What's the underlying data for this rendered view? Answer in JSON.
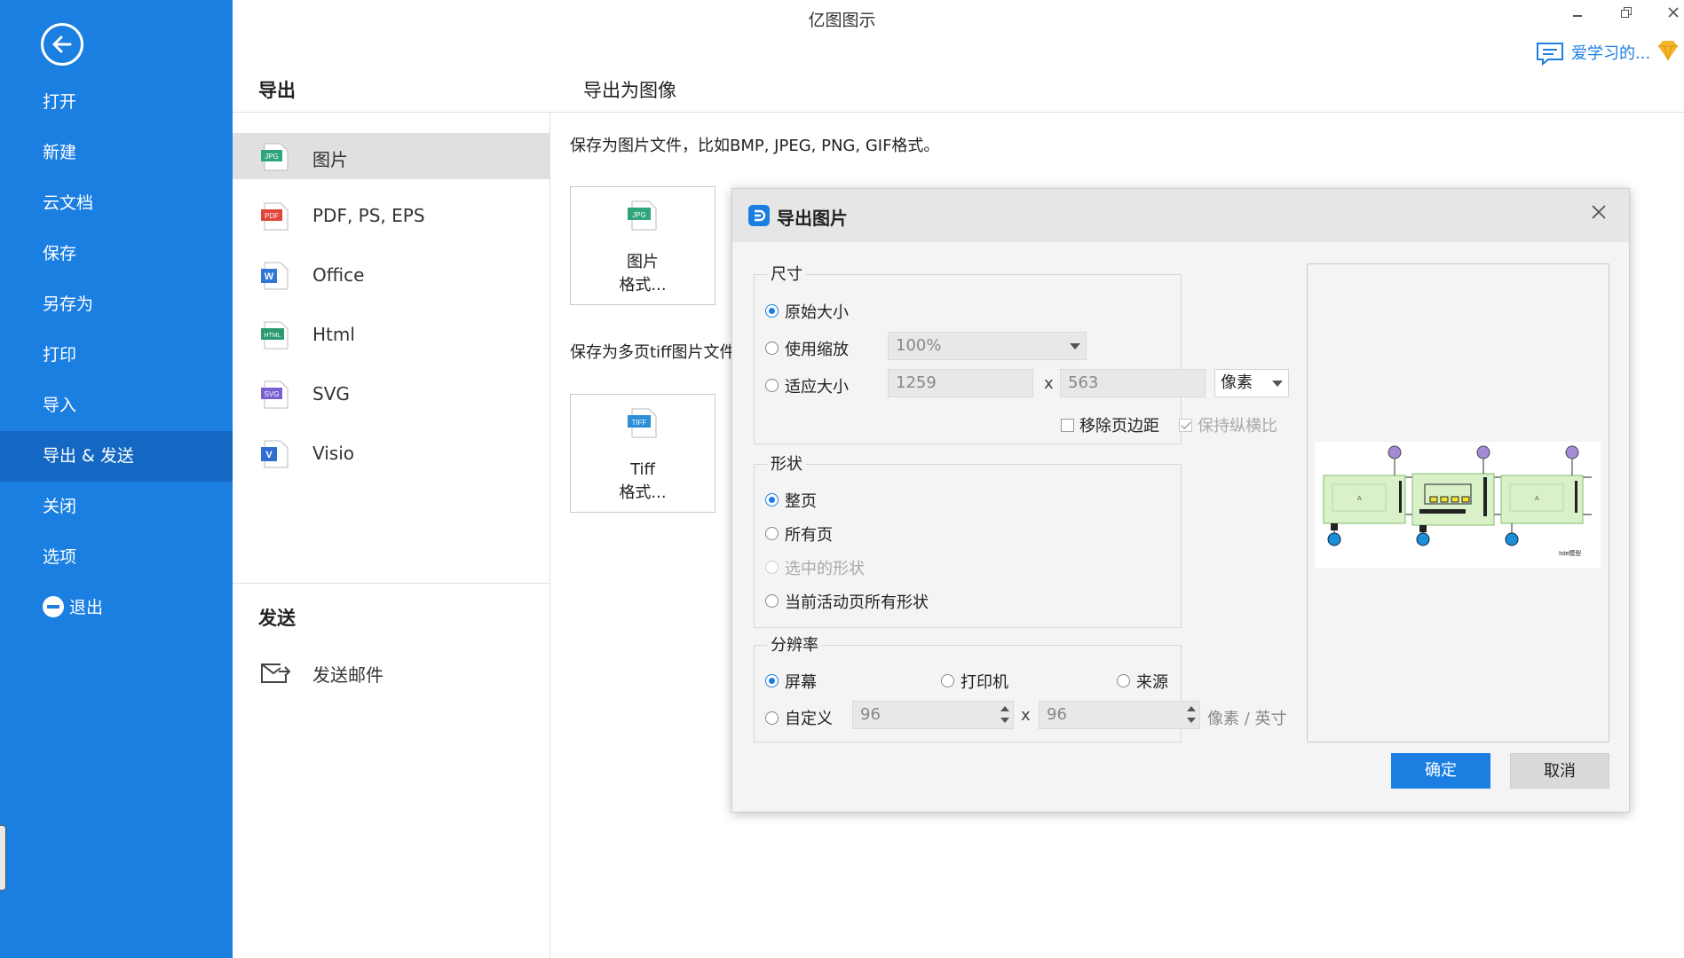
{
  "app": {
    "title": "亿图图示",
    "user_name": "爱学习的...",
    "accent": "#1b7fe2"
  },
  "sidebar": {
    "back_icon": "arrow-left-icon",
    "items": [
      {
        "label": "打开"
      },
      {
        "label": "新建"
      },
      {
        "label": "云文档"
      },
      {
        "label": "保存"
      },
      {
        "label": "另存为"
      },
      {
        "label": "打印"
      },
      {
        "label": "导入"
      },
      {
        "label": "导出 & 发送",
        "active": true
      },
      {
        "label": "关闭"
      },
      {
        "label": "选项"
      },
      {
        "label": "退出",
        "icon": "minus-circle-icon"
      }
    ]
  },
  "export_panel": {
    "heading": "导出",
    "formats": [
      {
        "label": "图片",
        "icon": "jpg-file-icon",
        "active": true
      },
      {
        "label": "PDF, PS, EPS",
        "icon": "pdf-file-icon"
      },
      {
        "label": "Office",
        "icon": "word-file-icon"
      },
      {
        "label": "Html",
        "icon": "html-file-icon"
      },
      {
        "label": "SVG",
        "icon": "svg-file-icon"
      },
      {
        "label": "Visio",
        "icon": "visio-file-icon"
      }
    ],
    "send_heading": "发送",
    "send_items": [
      {
        "label": "发送邮件",
        "icon": "mail-send-icon"
      }
    ]
  },
  "content": {
    "title": "导出为图像",
    "desc_image": "保存为图片文件，比如BMP, JPEG, PNG, GIF格式。",
    "card_image": {
      "line1": "图片",
      "line2": "格式..."
    },
    "desc_tiff": "保存为多页tiff图片文件",
    "card_tiff": {
      "line1": "Tiff",
      "line2": "格式..."
    }
  },
  "dialog": {
    "title": "导出图片",
    "size_group": {
      "label": "尺寸",
      "original_size": "原始大小",
      "use_zoom": "使用缩放",
      "zoom_value": "100%",
      "fit_size": "适应大小",
      "width": "1259",
      "x_sep": "x",
      "height": "563",
      "unit": "像素",
      "remove_margin": "移除页边距",
      "keep_ratio": "保持纵横比"
    },
    "shape_group": {
      "label": "形状",
      "whole_page": "整页",
      "all_pages": "所有页",
      "selected_shapes": "选中的形状",
      "current_page_shapes": "当前活动页所有形状"
    },
    "resolution_group": {
      "label": "分辨率",
      "screen": "屏幕",
      "printer": "打印机",
      "source": "来源",
      "custom": "自定义",
      "dpi_x": "96",
      "x_sep": "x",
      "dpi_y": "96",
      "unit": "像素 / 英寸"
    },
    "preview_caption": "Iste模型",
    "ok": "确定",
    "cancel": "取消"
  }
}
